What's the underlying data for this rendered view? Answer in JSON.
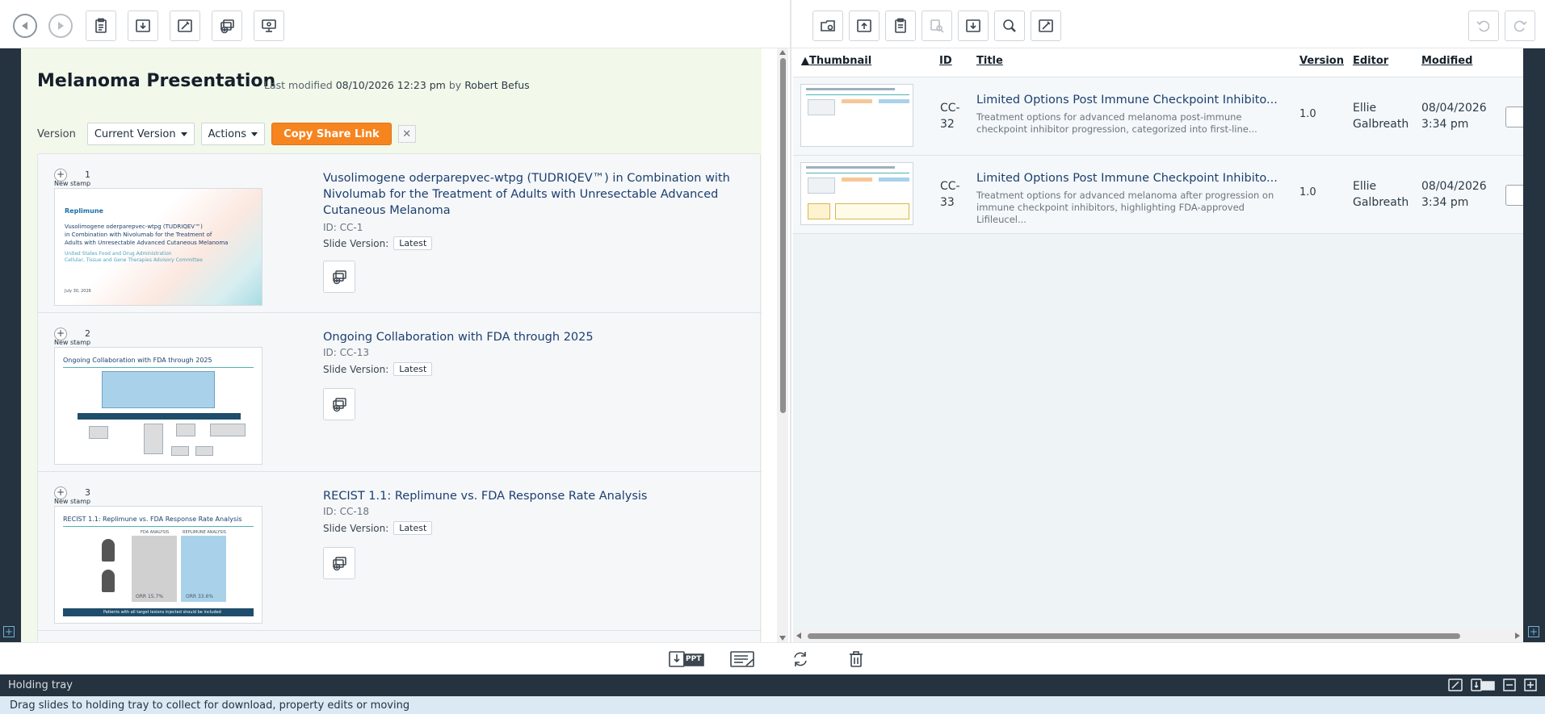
{
  "presentation": {
    "title": "Melanoma Presentation",
    "last_modified_label": "Last modified",
    "last_modified_date": "08/10/2026 12:23 pm",
    "by_label": "by",
    "author": "Robert Befus"
  },
  "version_bar": {
    "label": "Version",
    "current_version": "Current Version",
    "actions": "Actions",
    "copy_share": "Copy Share Link",
    "close": "✕"
  },
  "slides": [
    {
      "num": "1",
      "stamp": "New stamp",
      "title": "Vusolimogene oderparepvec-wtpg (TUDRIQEV™) in Combination with Nivolumab for the Treatment of Adults with Unresectable Advanced Cutaneous Melanoma",
      "id": "ID: CC-1",
      "version_label": "Slide Version:",
      "version": "Latest",
      "thumb": {
        "brand": "Replimune",
        "line1": "Vusolimogene oderparepvec-wtpg (TUDRIQEV™)",
        "line2": "in Combination with Nivolumab for the Treatment of",
        "line3": "Adults with Unresectable Advanced Cutaneous Melanoma",
        "sub1": "United States Food and Drug Administration",
        "sub2": "Cellular, Tissue and Gene Therapies Advisory Committee",
        "date": "July 30, 2026"
      }
    },
    {
      "num": "2",
      "stamp": "New stamp",
      "title": "Ongoing Collaboration with FDA through 2025",
      "id": "ID: CC-13",
      "version_label": "Slide Version:",
      "version": "Latest",
      "thumb": {
        "heading": "Ongoing Collaboration with FDA through 2025"
      }
    },
    {
      "num": "3",
      "stamp": "New stamp",
      "title": "RECIST 1.1: Replimune vs. FDA Response Rate Analysis",
      "id": "ID: CC-18",
      "version_label": "Slide Version:",
      "version": "Latest",
      "thumb": {
        "heading": "RECIST 1.1: Replimune vs. FDA Response Rate Analysis",
        "col1": "FDA ANALYSIS",
        "col2": "REPLIMUNE ANALYSIS",
        "orr1": "ORR 15.7%",
        "orr2": "ORR 33.6%",
        "footer": "Patients with all target lesions injected should be included"
      }
    }
  ],
  "library": {
    "columns": {
      "thumbnail": "▲Thumbnail",
      "id": "ID",
      "title": "Title",
      "version": "Version",
      "editor": "Editor",
      "modified": "Modified"
    },
    "rows": [
      {
        "id_1": "CC-",
        "id_2": "32",
        "title": "Limited Options Post Immune Checkpoint Inhibito...",
        "desc": "Treatment options for advanced melanoma post-immune checkpoint inhibitor progression, categorized into first-line...",
        "version": "1.0",
        "editor_1": "Ellie",
        "editor_2": "Galbreath",
        "date": "08/04/2026",
        "time": "3:34 pm"
      },
      {
        "id_1": "CC-",
        "id_2": "33",
        "title": "Limited Options Post Immune Checkpoint Inhibito...",
        "desc": "Treatment options for advanced melanoma after progression on immune checkpoint inhibitors, highlighting FDA-approved Lifileucel...",
        "version": "1.0",
        "editor_1": "Ellie",
        "editor_2": "Galbreath",
        "date": "08/04/2026",
        "time": "3:34 pm"
      }
    ]
  },
  "tray": {
    "title": "Holding tray",
    "message": "Drag slides to holding tray to collect for download, property edits or moving"
  },
  "icons": {
    "back": "back-arrow-icon",
    "forward": "forward-arrow-icon",
    "ppt": "PPT"
  }
}
